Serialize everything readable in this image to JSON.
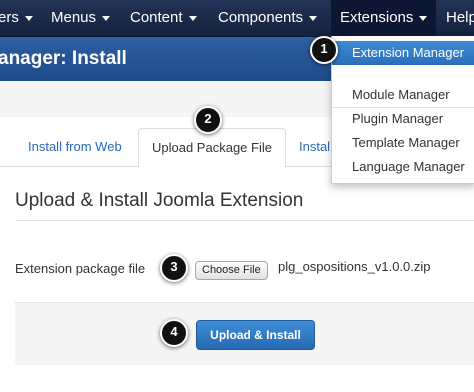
{
  "nav": {
    "items": [
      {
        "label": "ers"
      },
      {
        "label": "Menus"
      },
      {
        "label": "Content"
      },
      {
        "label": "Components"
      },
      {
        "label": "Extensions"
      },
      {
        "label": "Help"
      }
    ]
  },
  "header": {
    "title": "anager: Install"
  },
  "tabs": [
    {
      "label": "Install from Web"
    },
    {
      "label": "Upload Package File"
    },
    {
      "label": "Instal"
    }
  ],
  "section": {
    "title": "Upload & Install Joomla Extension"
  },
  "form": {
    "field_label": "Extension package file",
    "choose_file_label": "Choose File",
    "file_name": "plg_ospositions_v1.0.0.zip",
    "submit_label": "Upload & Install"
  },
  "dropdown": {
    "items": [
      {
        "label": "Extension Manager",
        "highlighted": true
      },
      {
        "label": "Module Manager"
      },
      {
        "label": "Plugin Manager"
      },
      {
        "label": "Template Manager"
      },
      {
        "label": "Language Manager"
      }
    ]
  },
  "badges": [
    "1",
    "2",
    "3",
    "4"
  ],
  "colors": {
    "nav_bg": "#1c2a4a",
    "header_bg": "#2d5fa3",
    "accent": "#2a6fbb",
    "link": "#2a69b8"
  }
}
